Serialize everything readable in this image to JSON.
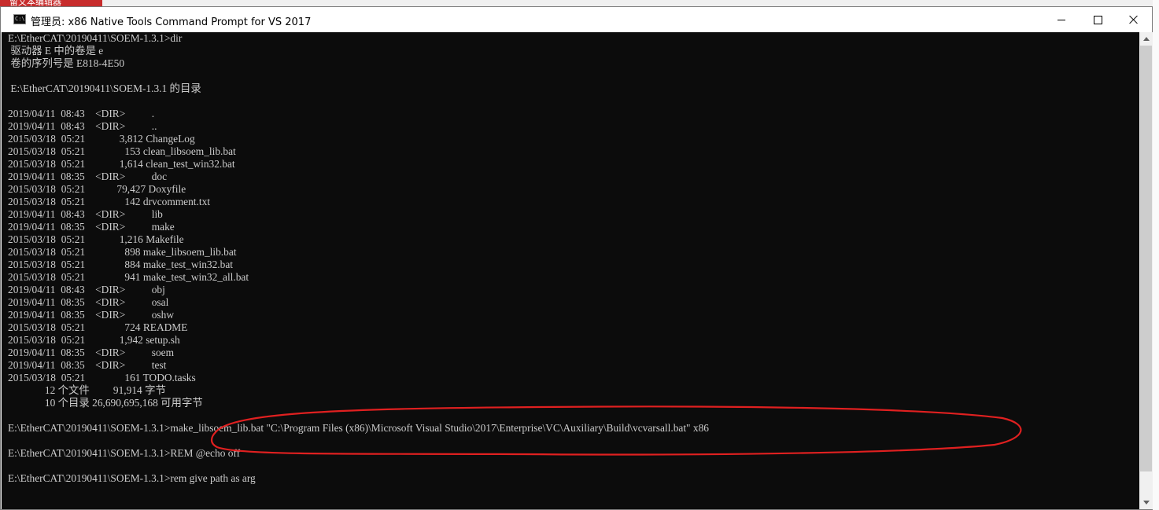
{
  "background": {
    "top_strip_text": "留文本编辑器",
    "accent_color": "#c72c2c"
  },
  "window": {
    "icon_label": "C:\\",
    "title": "管理员: x86 Native Tools Command Prompt for VS 2017",
    "controls": {
      "minimize": "minimize-icon",
      "maximize": "maximize-icon",
      "close": "close-icon"
    }
  },
  "console": {
    "background_color": "#0c0c0c",
    "text_color": "#cccccc",
    "lines": [
      "E:\\EtherCAT\\20190411\\SOEM-1.3.1>dir",
      " 驱动器 E 中的卷是 e",
      " 卷的序列号是 E818-4E50",
      "",
      " E:\\EtherCAT\\20190411\\SOEM-1.3.1 的目录",
      "",
      "2019/04/11  08:43    <DIR>          .",
      "2019/04/11  08:43    <DIR>          ..",
      "2015/03/18  05:21             3,812 ChangeLog",
      "2015/03/18  05:21               153 clean_libsoem_lib.bat",
      "2015/03/18  05:21             1,614 clean_test_win32.bat",
      "2019/04/11  08:35    <DIR>          doc",
      "2015/03/18  05:21            79,427 Doxyfile",
      "2015/03/18  05:21               142 drvcomment.txt",
      "2019/04/11  08:43    <DIR>          lib",
      "2019/04/11  08:35    <DIR>          make",
      "2015/03/18  05:21             1,216 Makefile",
      "2015/03/18  05:21               898 make_libsoem_lib.bat",
      "2015/03/18  05:21               884 make_test_win32.bat",
      "2015/03/18  05:21               941 make_test_win32_all.bat",
      "2019/04/11  08:43    <DIR>          obj",
      "2019/04/11  08:35    <DIR>          osal",
      "2019/04/11  08:35    <DIR>          oshw",
      "2015/03/18  05:21               724 README",
      "2015/03/18  05:21             1,942 setup.sh",
      "2019/04/11  08:35    <DIR>          soem",
      "2019/04/11  08:35    <DIR>          test",
      "2015/03/18  05:21               161 TODO.tasks",
      "              12 个文件         91,914 字节",
      "              10 个目录 26,690,695,168 可用字节",
      "",
      "E:\\EtherCAT\\20190411\\SOEM-1.3.1>make_libsoem_lib.bat \"C:\\Program Files (x86)\\Microsoft Visual Studio\\2017\\Enterprise\\VC\\Auxiliary\\Build\\vcvarsall.bat\" x86",
      "",
      "E:\\EtherCAT\\20190411\\SOEM-1.3.1>REM @echo off",
      "",
      "E:\\EtherCAT\\20190411\\SOEM-1.3.1>rem give path as arg",
      "",
      ""
    ]
  },
  "annotation": {
    "color": "#e02020"
  },
  "scrollbar": {
    "up": "scroll-up-arrow-icon",
    "down": "scroll-down-arrow-icon"
  }
}
